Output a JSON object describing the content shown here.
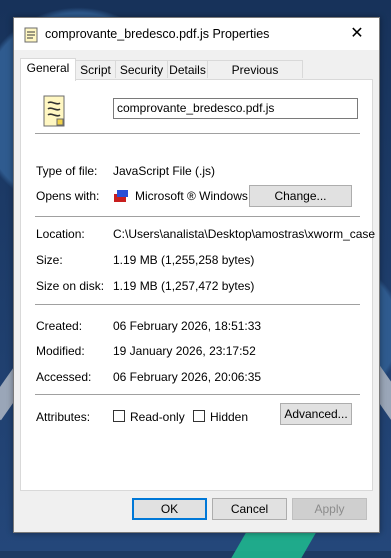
{
  "window": {
    "title": "comprovante_bredesco.pdf.js Properties",
    "close_glyph": "✕"
  },
  "tabs": [
    {
      "label": "General",
      "active": true
    },
    {
      "label": "Script"
    },
    {
      "label": "Security"
    },
    {
      "label": "Details"
    },
    {
      "label": "Previous Versions"
    }
  ],
  "general": {
    "file_name": "comprovante_bredesco.pdf.js",
    "type_label": "Type of file:",
    "type_value": "JavaScript File (.js)",
    "opens_label": "Opens with:",
    "opens_value": "Microsoft ® Windows B",
    "change_button": "Change...",
    "location_label": "Location:",
    "location_value": "C:\\Users\\analista\\Desktop\\amostras\\xworm_case",
    "size_label": "Size:",
    "size_value": "1.19 MB (1,255,258 bytes)",
    "size_on_disk_label": "Size on disk:",
    "size_on_disk_value": "1.19 MB (1,257,472 bytes)",
    "created_label": "Created:",
    "created_value": "06 February 2026, 18:51:33",
    "modified_label": "Modified:",
    "modified_value": "19 January 2026, 23:17:52",
    "accessed_label": "Accessed:",
    "accessed_value": "06 February 2026, 20:06:35",
    "attributes_label": "Attributes:",
    "readonly_label": "Read-only",
    "hidden_label": "Hidden",
    "advanced_button": "Advanced..."
  },
  "buttons": {
    "ok": "OK",
    "cancel": "Cancel",
    "apply": "Apply"
  },
  "colors": {
    "accent": "#0078d7"
  }
}
